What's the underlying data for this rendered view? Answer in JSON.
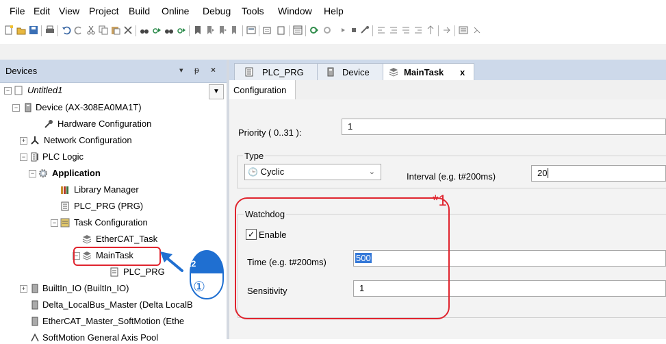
{
  "menu": [
    "File",
    "Edit",
    "View",
    "Project",
    "Build",
    "Online",
    "Debug",
    "Tools",
    "Window",
    "Help"
  ],
  "devices_panel": {
    "title": "Devices",
    "pin_glyph": "▾ ⊕ ✕"
  },
  "tree": {
    "project": "Untitled1",
    "device": "Device (AX-308EA0MA1T)",
    "hardware_configuration": "Hardware Configuration",
    "network_configuration": "Network Configuration",
    "plc_logic": "PLC Logic",
    "application": "Application",
    "library_manager": "Library Manager",
    "plc_prg": "PLC_PRG (PRG)",
    "task_configuration": "Task Configuration",
    "ethercat_task": "EtherCAT_Task",
    "maintask": "MainTask",
    "maintask_plc_prg": "PLC_PRG",
    "builtin_io": "BuiltIn_IO (BuiltIn_IO)",
    "localbus": "Delta_LocalBus_Master (Delta LocalB",
    "ethercat_master": "EtherCAT_Master_SoftMotion (Ethe",
    "softmotion_pool": "SoftMotion General Axis Pool"
  },
  "annotation": {
    "double_click": "x2",
    "step": "①",
    "note": "*1"
  },
  "tabs": {
    "plc_prg": "PLC_PRG",
    "device": "Device",
    "maintask": "MainTask",
    "close": "x"
  },
  "config": {
    "tab_label": "Configuration",
    "priority_label": "Priority ( 0..31 ):",
    "priority_value": "1",
    "type_label": "Type",
    "type_value": "Cyclic",
    "interval_label": "Interval (e.g. t#200ms)",
    "interval_value": "20",
    "watchdog_label": "Watchdog",
    "enable_label": "Enable",
    "enable_checked": true,
    "time_label": "Time (e.g. t#200ms)",
    "time_value": "500",
    "sensitivity_label": "Sensitivity",
    "sensitivity_value": "1"
  },
  "colors": {
    "highlight_red": "#e0242e",
    "annotation_blue": "#1f6fd1",
    "panel_header": "#cdd9ea"
  }
}
